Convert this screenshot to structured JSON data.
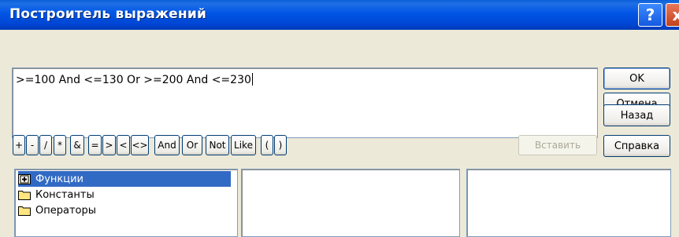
{
  "window": {
    "title": "Построитель выражений"
  },
  "titlebar_buttons": {
    "help": "?",
    "close": "x"
  },
  "expression": {
    "value": ">=100 And <=130 Or >=200 And <=230"
  },
  "side_buttons": {
    "ok": "OK",
    "cancel": "Отмена",
    "back": "Назад",
    "help": "Справка"
  },
  "operators": [
    "+",
    "-",
    "/",
    "*",
    "&",
    "=",
    ">",
    "<",
    "<>",
    "And",
    "Or",
    "Not",
    "Like",
    "(",
    ")"
  ],
  "paste_button": "Вставить",
  "categories": {
    "items": [
      {
        "label": "Функции",
        "icon": "folder-plus-icon",
        "selected": true
      },
      {
        "label": "Константы",
        "icon": "folder-icon",
        "selected": false
      },
      {
        "label": "Операторы",
        "icon": "folder-icon",
        "selected": false
      }
    ]
  },
  "colors": {
    "titlebar": "#0054e3",
    "selection": "#316ac5",
    "dialog_bg": "#ece9d8"
  }
}
